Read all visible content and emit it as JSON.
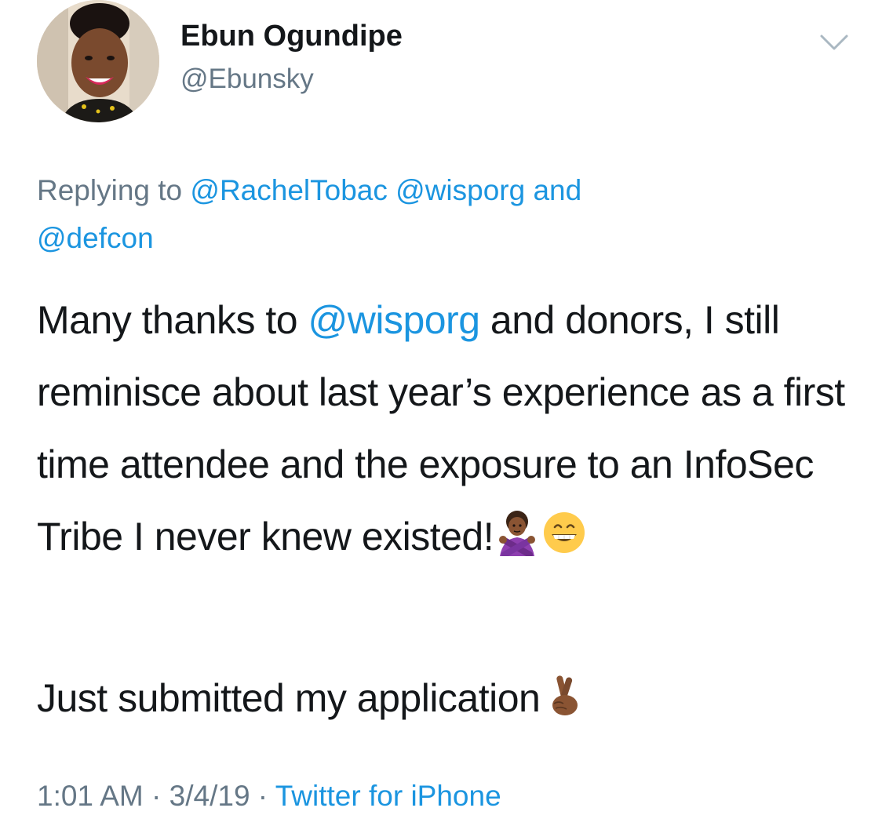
{
  "author": {
    "display_name": "Ebun Ogundipe",
    "handle": "@Ebunsky"
  },
  "menu": {
    "icon": "chevron-down-icon"
  },
  "reply": {
    "prefix": "Replying to ",
    "mentions": [
      "@RachelTobac",
      "@wisporg",
      "@defcon"
    ],
    "joiner": " and"
  },
  "tweet": {
    "part1_before": "Many thanks to ",
    "mention": "@wisporg",
    "part1_after": " and donors, I still reminisce about last year’s experience as a first time attendee and the exposure to an InfoSec Tribe I never knew existed!",
    "emoji1": "woman-gesturing-no-icon",
    "emoji2": "grinning-face-icon",
    "line2": "Just submitted my application",
    "emoji3": "crossed-fingers-icon"
  },
  "meta": {
    "time": "1:01 AM",
    "date": "3/4/19",
    "separator": " · ",
    "source": "Twitter for iPhone"
  },
  "colors": {
    "link": "#1b95e0",
    "secondary_text": "#657786",
    "primary_text": "#14171a"
  }
}
